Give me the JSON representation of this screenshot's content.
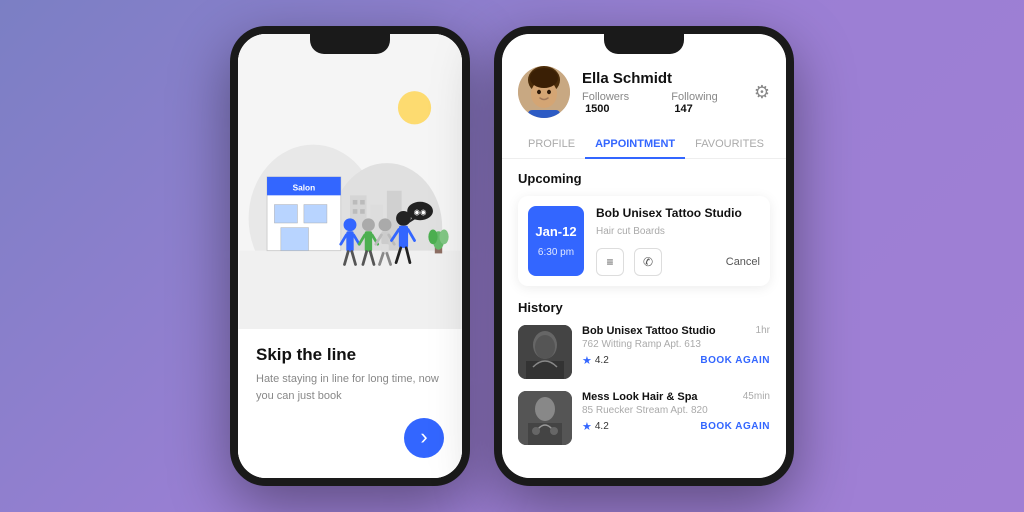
{
  "phone1": {
    "title": "Skip the line",
    "subtitle": "Hate staying in line for long time, now you can just book"
  },
  "phone2": {
    "profile": {
      "name": "Ella Schmidt",
      "followers_label": "Followers",
      "followers_count": "1500",
      "following_label": "Following",
      "following_count": "147"
    },
    "tabs": [
      {
        "label": "PROFILE",
        "active": false
      },
      {
        "label": "APPOINTMENT",
        "active": true
      },
      {
        "label": "FAVOURITES",
        "active": false
      }
    ],
    "upcoming_label": "Upcoming",
    "appointment": {
      "date": "Jan-12",
      "time": "6:30 pm",
      "business": "Bob Unisex Tattoo Studio",
      "services": "Hair cut  Boards",
      "cancel_label": "Cancel"
    },
    "history_label": "History",
    "history_items": [
      {
        "name": "Bob Unisex Tattoo Studio",
        "duration": "1hr",
        "address": "762 Witting Ramp Apt. 613",
        "rating": "4.2",
        "book_again": "BOOK AGAIN"
      },
      {
        "name": "Mess Look Hair & Spa",
        "duration": "45min",
        "address": "85 Ruecker Stream Apt. 820",
        "rating": "4.2",
        "book_again": "BOOK AGAIN"
      }
    ]
  }
}
